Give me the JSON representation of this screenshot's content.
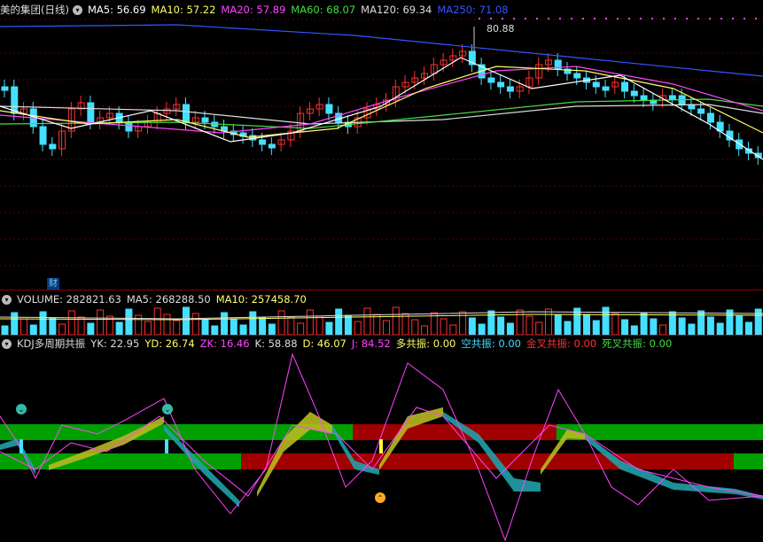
{
  "main_header": {
    "stock": "美的集团(日线)",
    "items": [
      {
        "label": "MA5: 56.69",
        "color": "#ffffff"
      },
      {
        "label": "MA10: 57.22",
        "color": "#ffff66"
      },
      {
        "label": "MA20: 57.89",
        "color": "#ff44ff"
      },
      {
        "label": "MA60: 68.07",
        "color": "#44dd44"
      },
      {
        "label": "MA120: 69.34",
        "color": "#dddddd"
      },
      {
        "label": "MA250: 71.08",
        "color": "#3355ff"
      }
    ]
  },
  "high_marker": "80.88",
  "cai_badge": "财",
  "volume_header": {
    "items": [
      {
        "label": "VOLUME: 282821.63",
        "color": "#dddddd"
      },
      {
        "label": "MA5: 268288.50",
        "color": "#dddddd"
      },
      {
        "label": "MA10: 257458.70",
        "color": "#ffff66"
      }
    ]
  },
  "kdj_header": {
    "items": [
      {
        "label": "KDJ多周期共振",
        "color": "#dddddd"
      },
      {
        "label": "YK: 22.95",
        "color": "#dddddd"
      },
      {
        "label": "YD: 26.74",
        "color": "#ffff66"
      },
      {
        "label": "ZK: 16.46",
        "color": "#ff44ff"
      },
      {
        "label": "K: 58.88",
        "color": "#dddddd"
      },
      {
        "label": "D: 46.07",
        "color": "#ffff66"
      },
      {
        "label": "J: 84.52",
        "color": "#ff44ff"
      },
      {
        "label": "多共振: 0.00",
        "color": "#ffff66"
      },
      {
        "label": "空共振: 0.00",
        "color": "#44ddff"
      },
      {
        "label": "金叉共振: 0.00",
        "color": "#ff3333"
      },
      {
        "label": "死叉共振: 0.00",
        "color": "#44dd44"
      }
    ]
  },
  "chart_data": {
    "type": "line",
    "title": "美的集团(日线)",
    "panels": [
      {
        "name": "price",
        "series": [
          "MA5",
          "MA10",
          "MA20",
          "MA60",
          "MA120",
          "MA250"
        ],
        "high": 80.88
      },
      {
        "name": "volume",
        "series": [
          "VOLUME",
          "MA5",
          "MA10"
        ]
      },
      {
        "name": "kdj",
        "series": [
          "YK",
          "YD",
          "ZK",
          "K",
          "D",
          "J"
        ]
      }
    ],
    "colors": {
      "up": "#ff3030",
      "down": "#44e0ff",
      "k": "#ffffff",
      "d": "#ffff66",
      "j": "#ff44ff",
      "bull": "#b8b820",
      "bear": "#20a0a8",
      "band_green": "#00a000",
      "band_red": "#a00000"
    }
  }
}
